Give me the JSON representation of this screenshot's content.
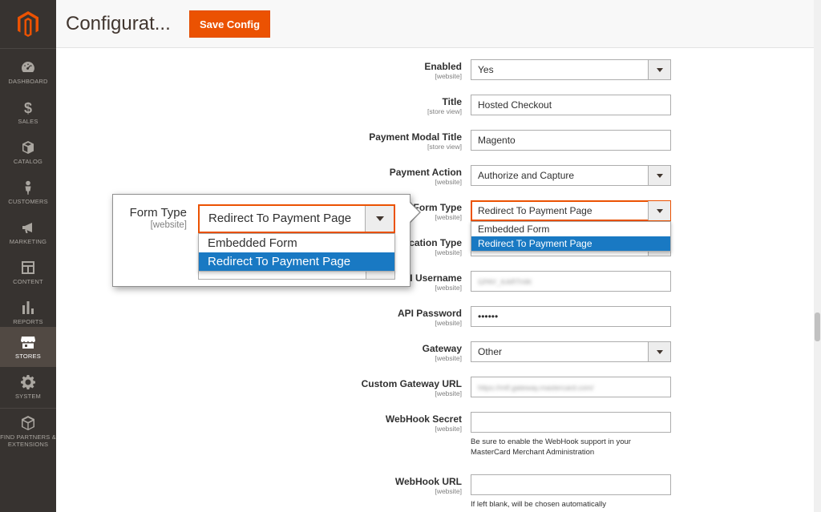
{
  "header": {
    "title": "Configurat...",
    "save_label": "Save Config"
  },
  "colors": {
    "accent": "#eb5202",
    "sidebar": "#373330",
    "selected": "#1979c3"
  },
  "sidebar": {
    "items": [
      {
        "label": "DASHBOARD",
        "icon": "dashboard-icon"
      },
      {
        "label": "SALES",
        "icon": "dollar-icon"
      },
      {
        "label": "CATALOG",
        "icon": "box-icon"
      },
      {
        "label": "CUSTOMERS",
        "icon": "person-icon"
      },
      {
        "label": "MARKETING",
        "icon": "megaphone-icon"
      },
      {
        "label": "CONTENT",
        "icon": "layout-icon"
      },
      {
        "label": "REPORTS",
        "icon": "bar-chart-icon"
      },
      {
        "label": "STORES",
        "icon": "store-icon",
        "active": true
      },
      {
        "label": "SYSTEM",
        "icon": "gear-icon"
      },
      {
        "label": "FIND PARTNERS & EXTENSIONS",
        "icon": "cube-icon"
      }
    ]
  },
  "form": {
    "enabled": {
      "label": "Enabled",
      "scope": "[website]",
      "value": "Yes"
    },
    "title": {
      "label": "Title",
      "scope": "[store view]",
      "value": "Hosted Checkout"
    },
    "modal_title": {
      "label": "Payment Modal Title",
      "scope": "[store view]",
      "value": "Magento"
    },
    "payment_action": {
      "label": "Payment Action",
      "scope": "[website]",
      "value": "Authorize and Capture"
    },
    "form_type": {
      "label": "Form Type",
      "scope": "[website]",
      "value": "Redirect To Payment Page",
      "options": [
        "Embedded Form",
        "Redirect To Payment Page"
      ]
    },
    "auth_type": {
      "label": "ication Type",
      "scope": "[website]"
    },
    "api_username": {
      "label": "PI Username",
      "scope": "[website]",
      "value": "GPAY_KARTHIK"
    },
    "api_password": {
      "label": "API Password",
      "scope": "[website]",
      "value": "••••••"
    },
    "gateway": {
      "label": "Gateway",
      "scope": "[website]",
      "value": "Other"
    },
    "custom_gateway_url": {
      "label": "Custom Gateway URL",
      "scope": "[website]",
      "value": "https://mtf.gateway.mastercard.com/"
    },
    "webhook_secret": {
      "label": "WebHook Secret",
      "scope": "[website]",
      "value": "",
      "note": "Be sure to enable the WebHook support in your MasterCard Merchant Administration"
    },
    "webhook_url": {
      "label": "WebHook URL",
      "scope": "[website]",
      "value": "",
      "note": "If left blank, will be chosen automatically"
    }
  },
  "zoom": {
    "label": "Form Type",
    "scope": "[website]",
    "value": "Redirect To Payment Page",
    "options": [
      "Embedded Form",
      "Redirect To Payment Page"
    ]
  }
}
